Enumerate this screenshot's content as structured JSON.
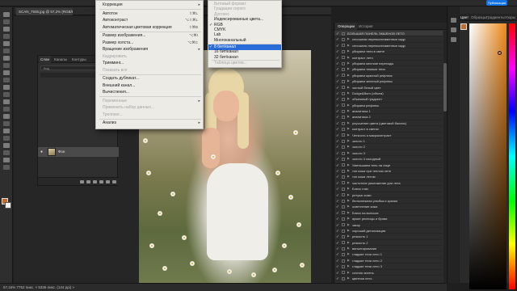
{
  "topbar": {
    "publish_label": "Публикация"
  },
  "document": {
    "tab_title": "SCAN_7935.jpg @ 57,2% (RGB/8*) ×"
  },
  "layers_panel": {
    "tabs": [
      "Слои",
      "Каналы",
      "Контуры"
    ],
    "search_placeholder": "Вид",
    "layer_name": "Фон"
  },
  "image_menu": {
    "items": [
      {
        "label": "Коррекция",
        "shortcut": "",
        "disabled": false,
        "submenu": true
      },
      {
        "label": "Автотон",
        "shortcut": "⇧⌘L",
        "disabled": false
      },
      {
        "label": "Автоконтраст",
        "shortcut": "⌥⇧⌘L",
        "disabled": false
      },
      {
        "label": "Автоматическая цветовая коррекция",
        "shortcut": "⇧⌘B",
        "disabled": false
      },
      {
        "label": "Размер изображения...",
        "shortcut": "⌥⌘I",
        "disabled": false
      },
      {
        "label": "Размер холста...",
        "shortcut": "⌥⌘C",
        "disabled": false
      },
      {
        "label": "Вращение изображения",
        "shortcut": "",
        "disabled": false,
        "submenu": true
      },
      {
        "label": "Кадрировать",
        "shortcut": "",
        "disabled": true
      },
      {
        "label": "Тримминг...",
        "shortcut": "",
        "disabled": false
      },
      {
        "label": "Показать все",
        "shortcut": "",
        "disabled": true
      },
      {
        "label": "Создать дубликат...",
        "shortcut": "",
        "disabled": false
      },
      {
        "label": "Внешний канал...",
        "shortcut": "",
        "disabled": false
      },
      {
        "label": "Вычисления...",
        "shortcut": "",
        "disabled": false
      },
      {
        "label": "Переменные",
        "shortcut": "",
        "disabled": true,
        "submenu": true
      },
      {
        "label": "Применить набор данных...",
        "shortcut": "",
        "disabled": true
      },
      {
        "label": "Треппинг...",
        "shortcut": "",
        "disabled": true
      },
      {
        "label": "Анализ",
        "shortcut": "",
        "disabled": false,
        "submenu": true
      }
    ]
  },
  "mode_menu": {
    "items": [
      {
        "label": "Битовый формат",
        "disabled": true,
        "checked": false,
        "selected": false
      },
      {
        "label": "Градации серого",
        "disabled": true,
        "checked": false,
        "selected": false
      },
      {
        "label": "Дуплекс",
        "disabled": true,
        "checked": false,
        "selected": false
      },
      {
        "label": "Индексированные цвета...",
        "disabled": false,
        "checked": false,
        "selected": false
      },
      {
        "label": "RGB",
        "disabled": false,
        "checked": true,
        "selected": false
      },
      {
        "label": "CMYK",
        "disabled": false,
        "checked": false,
        "selected": false
      },
      {
        "label": "Lab",
        "disabled": false,
        "checked": false,
        "selected": false
      },
      {
        "label": "Многоканальный",
        "disabled": false,
        "checked": false,
        "selected": false
      },
      {
        "label": "8 бит/канал",
        "disabled": false,
        "checked": true,
        "selected": true
      },
      {
        "label": "16 бит/канал",
        "disabled": false,
        "checked": false,
        "selected": false
      },
      {
        "label": "32 бит/канал",
        "disabled": false,
        "checked": false,
        "selected": false
      },
      {
        "label": "Таблица цветов...",
        "disabled": true,
        "checked": false,
        "selected": false
      }
    ]
  },
  "actions_panel": {
    "tabs": [
      "Операции",
      "История"
    ],
    "set_name": "БОЛЬШАЯ ПАНЕЛЬ ЭКШЕНОВ ЛЕТО",
    "rows": [
      "сплошная перевоспламенные кадр",
      "сплошная перевоспламенные кадр",
      "убираем тени в свете",
      "контраст лето",
      "убираем жесткие переходы",
      "убираем темные тени",
      "убираем красный рефлекс",
      "убираем зеленый рефлекс",
      "чистый белый цвет",
      "Dodge&Burn (объем)",
      "объемный градиент",
      "убираем рефлекс",
      "аналитика 1",
      "аналитика 2",
      "улучшение цвета (цветовой баланс)",
      "контраст в светах",
      "Четкость и микроконтраст",
      "золото 1",
      "золото 2",
      "золото 3",
      "золото 4 холодный",
      "Уменьшаем тень на лице",
      "тон кожи при теплом лете",
      "тон кожи летом",
      "частотное разложение для лета",
      "Блеск глаз",
      "ретушь кожи",
      "белоснежная улыбка и зрачки",
      "осветление кожи",
      "Блеск на волосах",
      "яркие ресницы и брови",
      "загар",
      "хороший детализация",
      "резкость 1",
      "резкость 2",
      "виньетирование",
      "гладкие тени лето 1",
      "гладкие тени лето 2",
      "гладкие тени лето 3",
      "сочная зелень",
      "цветная лето"
    ]
  },
  "color_panel": {
    "tabs": [
      "Цвет",
      "Образцы",
      "Градиенты",
      "Узоры"
    ],
    "fg_color": "#c46a2a"
  },
  "statusbar": {
    "text": "57,16%   7752 пикс. × 5336 пикс. (144 ppi)   >"
  }
}
